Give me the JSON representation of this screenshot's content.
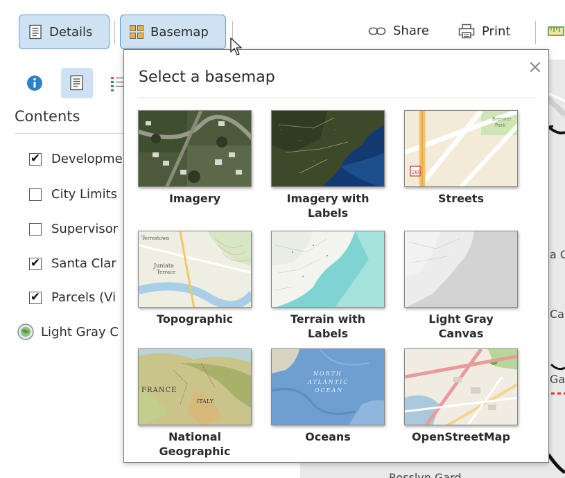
{
  "toolbar": {
    "details_label": "Details",
    "basemap_label": "Basemap",
    "share_label": "Share",
    "print_label": "Print"
  },
  "sidebar": {
    "contents_title": "Contents",
    "layers": [
      {
        "label": "Developme",
        "checked": true
      },
      {
        "label": "City Limits",
        "checked": false
      },
      {
        "label": "Supervisor",
        "checked": false
      },
      {
        "label": "Santa Clar",
        "checked": true
      },
      {
        "label": "Parcels (Vi",
        "checked": true
      }
    ],
    "basemap_layer_label": "Light Gray C"
  },
  "map": {
    "labels": [
      "a C",
      "Car",
      "Ga",
      "Rosslyn Gard"
    ]
  },
  "basemap_gallery": {
    "title": "Select a basemap",
    "close_glyph": "×",
    "tiles": [
      {
        "label_lines": [
          "Imagery"
        ],
        "icon": "imagery-thumbnail"
      },
      {
        "label_lines": [
          "Imagery with",
          "Labels"
        ],
        "icon": "imagery-labels-thumbnail"
      },
      {
        "label_lines": [
          "Streets"
        ],
        "icon": "streets-thumbnail"
      },
      {
        "label_lines": [
          "Topographic"
        ],
        "icon": "topographic-thumbnail"
      },
      {
        "label_lines": [
          "Terrain with",
          "Labels"
        ],
        "icon": "terrain-thumbnail"
      },
      {
        "label_lines": [
          "Light Gray",
          "Canvas"
        ],
        "icon": "light-gray-thumbnail"
      },
      {
        "label_lines": [
          "National",
          "Geographic"
        ],
        "icon": "natgeo-thumbnail"
      },
      {
        "label_lines": [
          "Oceans"
        ],
        "icon": "oceans-thumbnail"
      },
      {
        "label_lines": [
          "OpenStreetMap"
        ],
        "icon": "osm-thumbnail"
      }
    ],
    "thumb_text": {
      "streets_a": "Brenner",
      "streets_b": "Park",
      "streets_shield": "280",
      "topo_a": "Terrestown",
      "topo_b": "Juniata",
      "topo_c": "Terrace",
      "natgeo_a": "FRANCE",
      "natgeo_b": "ITALY",
      "oceans_a": "NORTH",
      "oceans_b": "ATLANTIC",
      "oceans_c": "OCEAN"
    }
  },
  "colors": {
    "button_bg": "#cfe2f3",
    "button_border": "#5b9bd5",
    "info_icon": "#2f80c8"
  }
}
